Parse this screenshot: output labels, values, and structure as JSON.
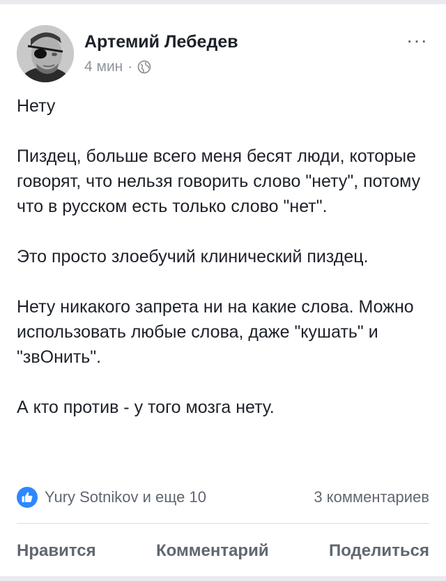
{
  "post": {
    "author": "Артемий Лебедев",
    "time": "4 мин",
    "separator": "·",
    "privacy_icon": "globe-icon",
    "more_label": "···",
    "paragraphs": [
      "Нету",
      "Пиздец, больше всего меня бесят люди, которые говорят, что нельзя говорить слово \"нету\", потому что в русском есть только слово \"нет\".",
      "Это просто злоебучий клинический пиздец.",
      "Нету никакого запрета ни на какие слова. Можно использовать любые слова, даже \"кушать\" и \"звОнить\".",
      "А кто против - у того мозга нету."
    ]
  },
  "reactions": {
    "icon": "like-icon",
    "summary": "Yury Sotnikov и еще 10",
    "comments": "3 комментариев"
  },
  "actions": {
    "like": "Нравится",
    "comment": "Комментарий",
    "share": "Поделиться"
  },
  "colors": {
    "background": "#e9ebee",
    "card": "#ffffff",
    "text": "#1d2129",
    "secondary_text": "#606770",
    "meta_text": "#90949c",
    "like_blue": "#2d88ff"
  }
}
